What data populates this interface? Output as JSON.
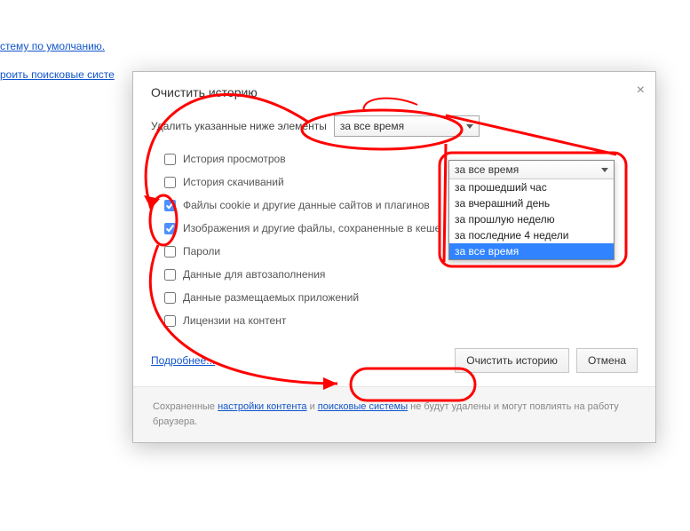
{
  "background_links": {
    "link1": "стему по умолчанию.",
    "link2": "роить поисковые систе"
  },
  "dialog": {
    "title": "Очистить историю",
    "close_label": "×",
    "prompt": "Удалить указанные ниже элементы",
    "select_value": "за все время",
    "options": [
      {
        "label": "История просмотров",
        "checked": false
      },
      {
        "label": "История скачиваний",
        "checked": false
      },
      {
        "label": "Файлы cookie и другие данные сайтов и плагинов",
        "checked": true
      },
      {
        "label": "Изображения и другие файлы, сохраненные в кеше",
        "checked": true
      },
      {
        "label": "Пароли",
        "checked": false
      },
      {
        "label": "Данные для автозаполнения",
        "checked": false
      },
      {
        "label": "Данные размещаемых приложений",
        "checked": false
      },
      {
        "label": "Лицензии на контент",
        "checked": false
      }
    ],
    "more_label": "Подробнее...",
    "clear_button": "Очистить историю",
    "cancel_button": "Отмена",
    "footer_pre": "Сохраненные ",
    "footer_link1": "настройки контента",
    "footer_mid": " и ",
    "footer_link2": "поисковые системы",
    "footer_post": " не будут удалены и могут повлиять на работу браузера."
  },
  "dropdown": {
    "header": "за все время",
    "items": [
      "за прошедший час",
      "за вчерашний день",
      "за прошлую неделю",
      "за последние 4 недели",
      "за все время"
    ],
    "selected_index": 4
  }
}
